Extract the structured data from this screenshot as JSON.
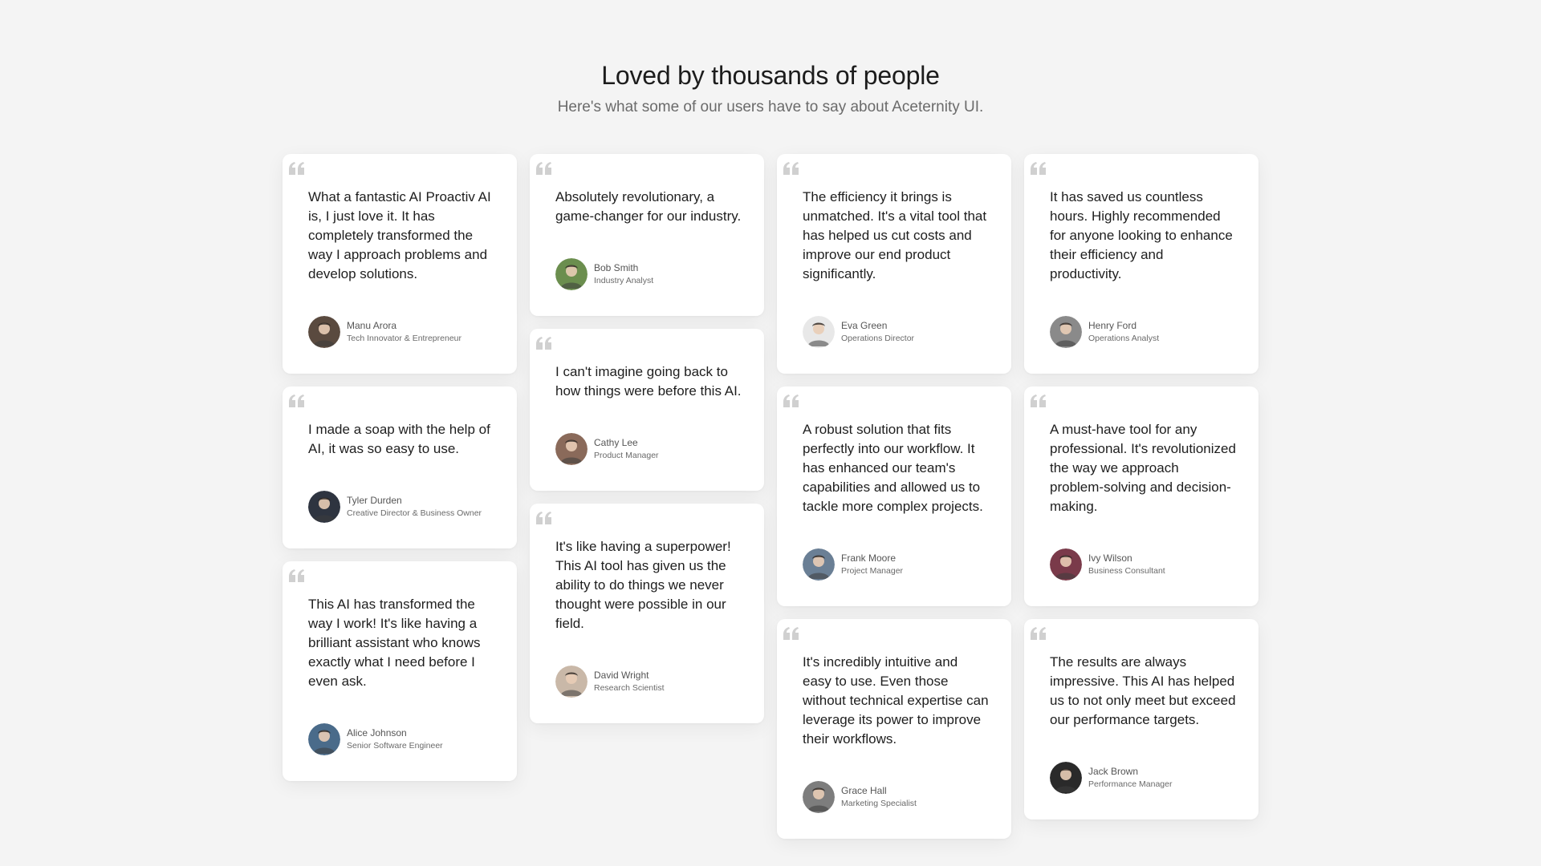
{
  "header": {
    "title": "Loved by thousands of people",
    "subtitle": "Here's what some of our users have to say about Aceternity UI."
  },
  "columns": [
    {
      "cards": [
        {
          "quote": "What a fantastic AI Proactiv AI is, I just love it. It has completely transformed the way I approach problems and develop solutions.",
          "name": "Manu Arora",
          "role": "Tech Innovator & Entrepreneur",
          "avatar_icon": "avatar-manu-arora",
          "avatar_color": "#5a4a3f"
        },
        {
          "quote": "I made a soap with the help of AI, it was so easy to use.",
          "name": "Tyler Durden",
          "role": "Creative Director & Business Owner",
          "avatar_icon": "avatar-tyler-durden",
          "avatar_color": "#2e3440"
        },
        {
          "quote": "This AI has transformed the way I work! It's like having a brilliant assistant who knows exactly what I need before I even ask.",
          "name": "Alice Johnson",
          "role": "Senior Software Engineer",
          "avatar_icon": "avatar-alice-johnson",
          "avatar_color": "#4a6b8a"
        }
      ]
    },
    {
      "cards": [
        {
          "quote": "Absolutely revolutionary, a game-changer for our industry.",
          "name": "Bob Smith",
          "role": "Industry Analyst",
          "avatar_icon": "avatar-bob-smith",
          "avatar_color": "#6b8e4e"
        },
        {
          "quote": "I can't imagine going back to how things were before this AI.",
          "name": "Cathy Lee",
          "role": "Product Manager",
          "avatar_icon": "avatar-cathy-lee",
          "avatar_color": "#8a6a5a"
        },
        {
          "quote": "It's like having a superpower! This AI tool has given us the ability to do things we never thought were possible in our field.",
          "name": "David Wright",
          "role": "Research Scientist",
          "avatar_icon": "avatar-david-wright",
          "avatar_color": "#c9b8a8"
        }
      ]
    },
    {
      "cards": [
        {
          "quote": "The efficiency it brings is unmatched. It's a vital tool that has helped us cut costs and improve our end product significantly.",
          "name": "Eva Green",
          "role": "Operations Director",
          "avatar_icon": "avatar-eva-green",
          "avatar_color": "#e8e8e8"
        },
        {
          "quote": "A robust solution that fits perfectly into our workflow. It has enhanced our team's capabilities and allowed us to tackle more complex projects.",
          "name": "Frank Moore",
          "role": "Project Manager",
          "avatar_icon": "avatar-frank-moore",
          "avatar_color": "#6a7f95"
        },
        {
          "quote": "It's incredibly intuitive and easy to use. Even those without technical expertise can leverage its power to improve their workflows.",
          "name": "Grace Hall",
          "role": "Marketing Specialist",
          "avatar_icon": "avatar-grace-hall",
          "avatar_color": "#7d7d7d"
        }
      ]
    },
    {
      "cards": [
        {
          "quote": "It has saved us countless hours. Highly recommended for anyone looking to enhance their efficiency and productivity.",
          "name": "Henry Ford",
          "role": "Operations Analyst",
          "avatar_icon": "avatar-henry-ford",
          "avatar_color": "#8a8a8a"
        },
        {
          "quote": "A must-have tool for any professional. It's revolutionized the way we approach problem-solving and decision-making.",
          "name": "Ivy Wilson",
          "role": "Business Consultant",
          "avatar_icon": "avatar-ivy-wilson",
          "avatar_color": "#7a3a4a"
        },
        {
          "quote": "The results are always impressive. This AI has helped us to not only meet but exceed our performance targets.",
          "name": "Jack Brown",
          "role": "Performance Manager",
          "avatar_icon": "avatar-jack-brown",
          "avatar_color": "#2a2a2a"
        }
      ]
    }
  ],
  "colors": {
    "background": "#f4f4f4",
    "card": "#ffffff",
    "quote_icon": "#d0d0d0"
  }
}
